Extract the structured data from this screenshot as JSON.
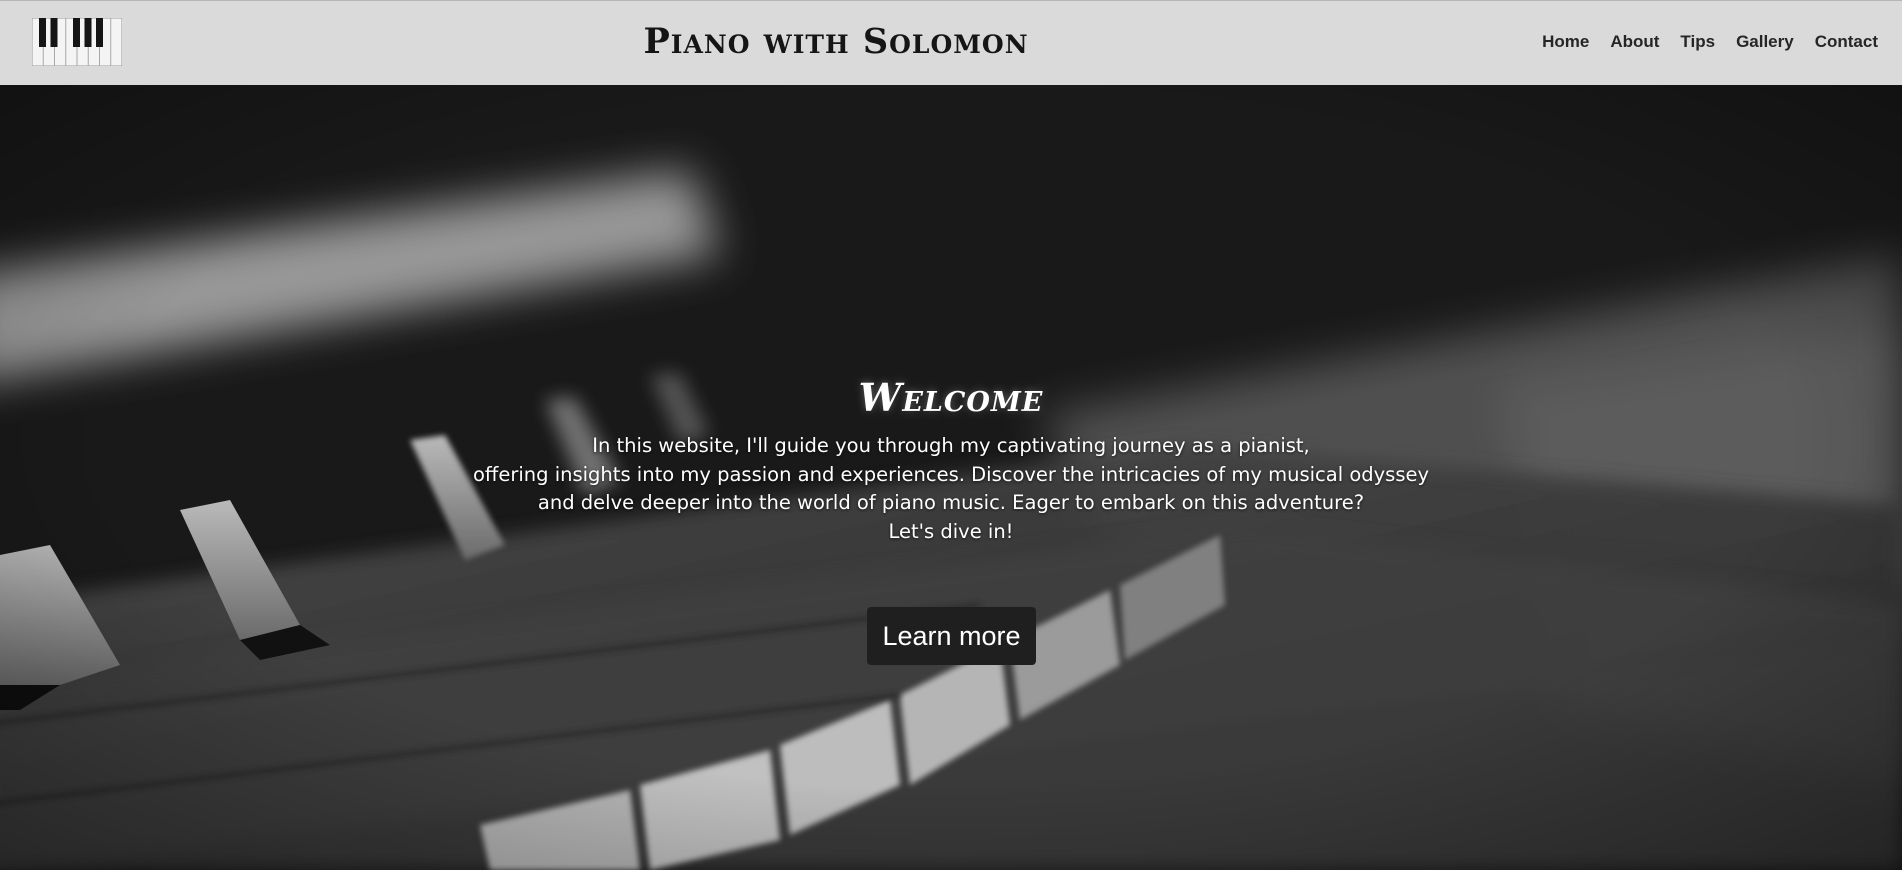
{
  "header": {
    "title": "Piano with Solomon",
    "logo_icon": "piano-keys-icon",
    "nav": [
      "Home",
      "About",
      "Tips",
      "Gallery",
      "Contact"
    ]
  },
  "hero": {
    "background": "blurred black-and-white piano keys photo",
    "heading": "Welcome",
    "text_lines": [
      "In this website, I'll guide you through my captivating journey as a pianist,",
      "offering insights into my passion and experiences. Discover the intricacies of my musical odyssey",
      "and delve deeper into the world of piano music. Eager to embark on this adventure?",
      "Let's dive in!"
    ],
    "button_label": "Learn more"
  },
  "colors": {
    "header_bg": "#dadada",
    "text_dark": "#151515",
    "button_bg": "#1f1f1f",
    "hero_text": "#ffffff"
  }
}
